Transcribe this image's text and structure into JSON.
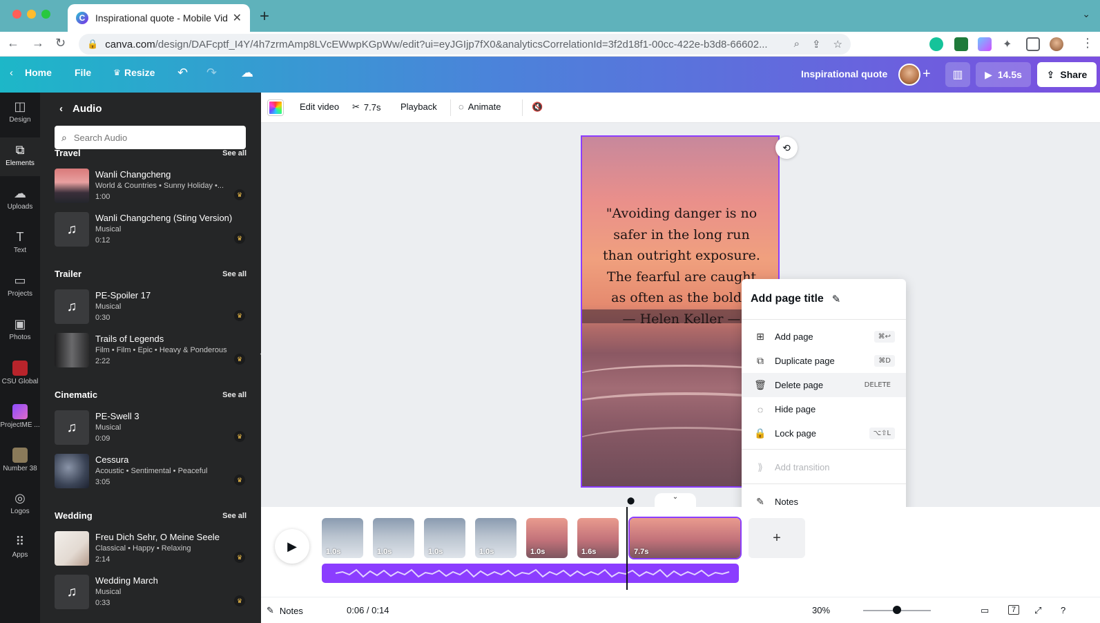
{
  "browser": {
    "tab_title": "Inspirational quote - Mobile Vid",
    "url_host": "canva.com",
    "url_path": "/design/DAFcptf_I4Y/4h7zrmAmp8LVcEWwpKGpWw/edit?ui=eyJGIjp7fX0&analyticsCorrelationId=3f2d18f1-00cc-422e-b3d8-66602..."
  },
  "header": {
    "home": "Home",
    "file": "File",
    "resize": "Resize",
    "design_title": "Inspirational quote",
    "play_duration": "14.5s",
    "share": "Share"
  },
  "rail": [
    {
      "label": "Design",
      "icon": "design-icon"
    },
    {
      "label": "Elements",
      "icon": "elements-icon"
    },
    {
      "label": "Uploads",
      "icon": "uploads-icon"
    },
    {
      "label": "Text",
      "icon": "text-icon"
    },
    {
      "label": "Projects",
      "icon": "projects-icon"
    },
    {
      "label": "Photos",
      "icon": "photos-icon"
    },
    {
      "label": "CSU Global",
      "icon": "csu-global-app-icon"
    },
    {
      "label": "ProjectME ...",
      "icon": "projectme-app-icon"
    },
    {
      "label": "Number 38",
      "icon": "number38-app-icon"
    },
    {
      "label": "Logos",
      "icon": "logos-icon"
    },
    {
      "label": "Apps",
      "icon": "apps-icon"
    }
  ],
  "panel": {
    "title": "Audio",
    "search_placeholder": "Search Audio",
    "see_all": "See all",
    "sections": [
      {
        "title": "Travel",
        "tracks": [
          {
            "name": "Wanli Changcheng",
            "meta": "World & Countries • Sunny Holiday •...",
            "duration": "1:00"
          },
          {
            "name": "Wanli Changcheng (Sting Version)",
            "meta": "Musical",
            "duration": "0:12"
          }
        ]
      },
      {
        "title": "Trailer",
        "tracks": [
          {
            "name": "PE-Spoiler 17",
            "meta": "Musical",
            "duration": "0:30"
          },
          {
            "name": "Trails of Legends",
            "meta": "Film • Film • Epic • Heavy & Ponderous",
            "duration": "2:22"
          }
        ]
      },
      {
        "title": "Cinematic",
        "tracks": [
          {
            "name": "PE-Swell 3",
            "meta": "Musical",
            "duration": "0:09"
          },
          {
            "name": "Cessura",
            "meta": "Acoustic • Sentimental • Peaceful",
            "duration": "3:05"
          }
        ]
      },
      {
        "title": "Wedding",
        "tracks": [
          {
            "name": "Freu Dich Sehr, O Meine Seele",
            "meta": "Classical • Happy • Relaxing",
            "duration": "2:14"
          },
          {
            "name": "Wedding March",
            "meta": "Musical",
            "duration": "0:33"
          }
        ]
      }
    ]
  },
  "toolbar": {
    "edit_video": "Edit video",
    "trim": "7.7s",
    "playback": "Playback",
    "animate": "Animate"
  },
  "canvas": {
    "quote_lines": [
      "\"Avoiding danger is no",
      "safer in the long run",
      "than outright exposure.",
      "The fearful are caught",
      "as often as the bold.\"",
      "— Helen Keller —"
    ]
  },
  "context_menu": {
    "title": "Add page title",
    "items": [
      {
        "label": "Add page",
        "shortcut": "⌘↩",
        "icon": "add-page-icon",
        "disabled": false
      },
      {
        "label": "Duplicate page",
        "shortcut": "⌘D",
        "icon": "duplicate-page-icon",
        "disabled": false
      },
      {
        "label": "Delete page",
        "shortcut": "DELETE",
        "icon": "trash-icon",
        "disabled": false
      },
      {
        "label": "Hide page",
        "shortcut": "",
        "icon": "hide-eye-icon",
        "disabled": false
      },
      {
        "label": "Lock page",
        "shortcut": "⌥⇧L",
        "icon": "lock-icon",
        "disabled": false
      },
      {
        "label": "Add transition",
        "shortcut": "",
        "icon": "transition-icon",
        "disabled": true
      },
      {
        "label": "Notes",
        "shortcut": "",
        "icon": "notes-icon",
        "disabled": false
      }
    ]
  },
  "timeline": {
    "clips": [
      "1.0s",
      "1.0s",
      "1.0s",
      "1.0s",
      "1.0s",
      "1.6s",
      "7.7s"
    ]
  },
  "footer": {
    "notes": "Notes",
    "time": "0:06 / 0:14",
    "zoom": "30%",
    "page_count": "7"
  }
}
